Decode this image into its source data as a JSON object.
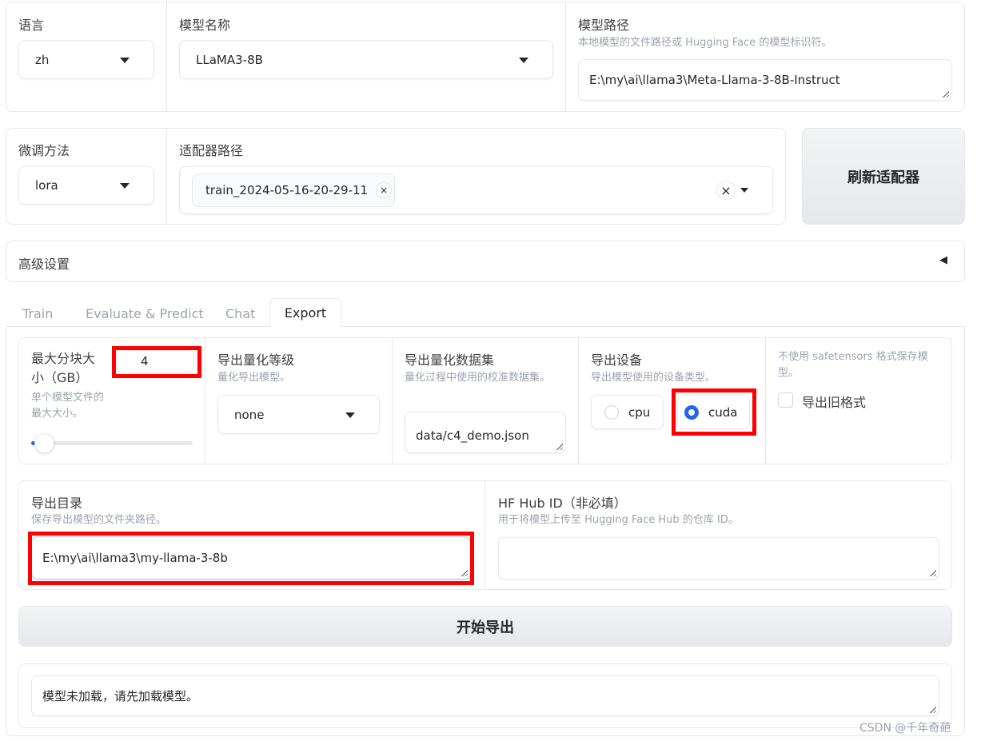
{
  "top": {
    "language": {
      "label": "语言",
      "value": "zh"
    },
    "model_name": {
      "label": "模型名称",
      "value": "LLaMA3-8B"
    },
    "model_path": {
      "label": "模型路径",
      "desc": "本地模型的文件路径或 Hugging Face 的模型标识符。",
      "value": "E:\\my\\ai\\llama3\\Meta-Llama-3-8B-Instruct"
    }
  },
  "adapter": {
    "method": {
      "label": "微调方法",
      "value": "lora"
    },
    "path": {
      "label": "适配器路径",
      "chip": "train_2024-05-16-20-29-11",
      "chip_remove": "×",
      "clear": "×"
    },
    "refresh_label": "刷新适配器"
  },
  "advanced": {
    "label": "高级设置",
    "toggle": "◀"
  },
  "tabs": [
    "Train",
    "Evaluate & Predict",
    "Chat",
    "Export"
  ],
  "export": {
    "max_shard": {
      "label": "最大分块大小（GB）",
      "desc": "单个模型文件的最大大小。",
      "value": "4",
      "slider_fraction": 0.01
    },
    "quant_bit": {
      "label": "导出量化等级",
      "desc": "量化导出模型。",
      "value": "none"
    },
    "quant_dataset": {
      "label": "导出量化数据集",
      "desc": "量化过程中使用的校准数据集。",
      "value": "data/c4_demo.json"
    },
    "device": {
      "label": "导出设备",
      "desc": "导出模型使用的设备类型。",
      "options": [
        "cpu",
        "cuda"
      ],
      "selected": "cuda"
    },
    "legacy": {
      "desc": "不使用 safetensors 格式保存模型。",
      "label": "导出旧格式",
      "checked": false
    },
    "dir": {
      "label": "导出目录",
      "desc": "保存导出模型的文件夹路径。",
      "value": "E:\\my\\ai\\llama3\\my-llama-3-8b"
    },
    "hub": {
      "label": "HF Hub ID（非必填）",
      "desc": "用于将模型上传至 Hugging Face Hub 的仓库 ID。",
      "value": ""
    },
    "start_label": "开始导出",
    "output": "模型未加载，请先加载模型。"
  },
  "watermark": "CSDN @千年奇葩",
  "colors": {
    "accent": "#2563eb",
    "highlight": "#ff0000"
  }
}
